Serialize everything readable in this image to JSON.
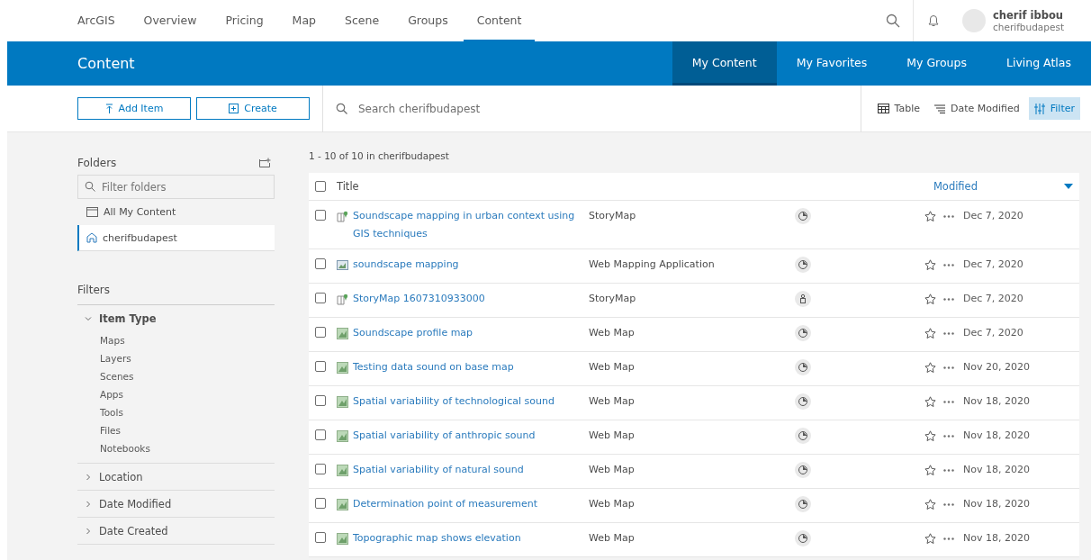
{
  "top_nav": {
    "items": [
      {
        "label": "ArcGIS",
        "selected": false
      },
      {
        "label": "Overview",
        "selected": false
      },
      {
        "label": "Pricing",
        "selected": false
      },
      {
        "label": "Map",
        "selected": false
      },
      {
        "label": "Scene",
        "selected": false
      },
      {
        "label": "Groups",
        "selected": false
      },
      {
        "label": "Content",
        "selected": true
      }
    ],
    "user": {
      "name": "cherif ibbou",
      "username": "cherifbudapest"
    }
  },
  "header": {
    "title": "Content",
    "tabs": [
      {
        "label": "My Content",
        "selected": true
      },
      {
        "label": "My Favorites",
        "selected": false
      },
      {
        "label": "My Groups",
        "selected": false
      },
      {
        "label": "Living Atlas",
        "selected": false
      }
    ]
  },
  "toolbar": {
    "buttons": [
      "Add Item",
      "Create"
    ],
    "search": {
      "placeholder": "Search cherifbudapest"
    },
    "view": "Table",
    "sort": "Date Modified",
    "filter": {
      "label": "Filter",
      "selected": true
    }
  },
  "sidebar": {
    "folders_title": "Folders",
    "folder_filter": {
      "placeholder": "Filter folders"
    },
    "folders": [
      {
        "label": "All My Content",
        "kind": "all",
        "selected": false
      },
      {
        "label": "cherifbudapest",
        "kind": "home",
        "selected": true
      }
    ],
    "filters_title": "Filters",
    "filters": [
      {
        "label": "Item Type",
        "expanded": true,
        "children": [
          "Maps",
          "Layers",
          "Scenes",
          "Apps",
          "Tools",
          "Files",
          "Notebooks"
        ]
      },
      {
        "label": "Location",
        "expanded": false
      },
      {
        "label": "Date Modified",
        "expanded": false
      },
      {
        "label": "Date Created",
        "expanded": false
      }
    ]
  },
  "results": {
    "count": "1 - 10 of 10 in cherifbudapest",
    "columns": {
      "title": "Title",
      "modified": "Modified"
    },
    "checked": false,
    "rows": [
      {
        "title": "Soundscape mapping in urban context using GIS techniques",
        "kind": "storymap",
        "type": "StoryMap",
        "share": {
          "kind": "public"
        },
        "checked": false,
        "date": "Dec 7, 2020"
      },
      {
        "title": "soundscape mapping",
        "kind": "app",
        "type": "Web Mapping Application",
        "share": {
          "kind": "public"
        },
        "checked": false,
        "date": "Dec 7, 2020"
      },
      {
        "title": "StoryMap 1607310933000",
        "kind": "storymap",
        "type": "StoryMap",
        "share": {
          "kind": "private"
        },
        "checked": false,
        "date": "Dec 7, 2020"
      },
      {
        "title": "Soundscape profile map",
        "kind": "webmap",
        "type": "Web Map",
        "share": {
          "kind": "public"
        },
        "checked": false,
        "date": "Dec 7, 2020"
      },
      {
        "title": "Testing data sound on base map",
        "kind": "webmap",
        "type": "Web Map",
        "share": {
          "kind": "public"
        },
        "checked": false,
        "date": "Nov 20, 2020"
      },
      {
        "title": "Spatial variability of technological sound",
        "kind": "webmap",
        "type": "Web Map",
        "share": {
          "kind": "public"
        },
        "checked": false,
        "date": "Nov 18, 2020"
      },
      {
        "title": "Spatial variability of anthropic sound",
        "kind": "webmap",
        "type": "Web Map",
        "share": {
          "kind": "public"
        },
        "checked": false,
        "date": "Nov 18, 2020"
      },
      {
        "title": "Spatial variability of natural sound",
        "kind": "webmap",
        "type": "Web Map",
        "share": {
          "kind": "public"
        },
        "checked": false,
        "date": "Nov 18, 2020"
      },
      {
        "title": "Determination point of measurement",
        "kind": "webmap",
        "type": "Web Map",
        "share": {
          "kind": "public"
        },
        "checked": false,
        "date": "Nov 18, 2020"
      },
      {
        "title": "Topographic map shows elevation",
        "kind": "webmap",
        "type": "Web Map",
        "share": {
          "kind": "public"
        },
        "checked": false,
        "date": "Nov 18, 2020"
      }
    ]
  }
}
